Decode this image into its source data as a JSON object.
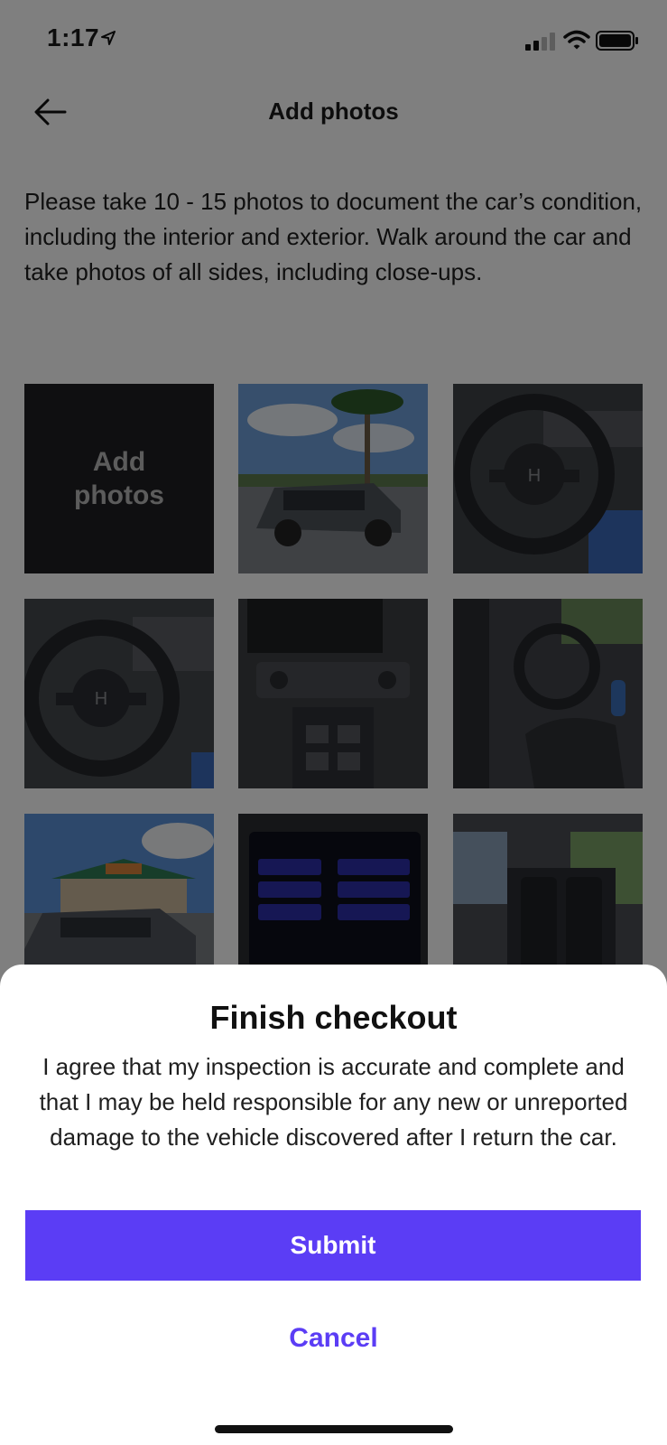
{
  "status_bar": {
    "time": "1:17"
  },
  "header": {
    "title": "Add photos"
  },
  "intro": "Please take 10 - 15 photos to document the car’s condition, including the interior and exterior. Walk around the car and take photos of all sides, including close-ups.",
  "grid": {
    "add_tile": {
      "line1": "Add",
      "line2": "photos"
    },
    "photos": [
      "car-exterior-palm-trees",
      "steering-wheel-interior",
      "steering-wheel-dashboard",
      "center-console-gear-shift",
      "driver-seat-open-door",
      "car-front-of-store",
      "infotainment-screen",
      "rear-seats-interior"
    ]
  },
  "sheet": {
    "title": "Finish checkout",
    "body": "I agree that my inspection is accurate and complete and that I may be held responsible for any new or unreported damage to the vehicle discovered after I return the car.",
    "submit_label": "Submit",
    "cancel_label": "Cancel"
  },
  "colors": {
    "accent": "#5b3df5",
    "overlay": "rgba(0,0,0,0.5)",
    "add_tile_bg": "#1f1f23"
  }
}
